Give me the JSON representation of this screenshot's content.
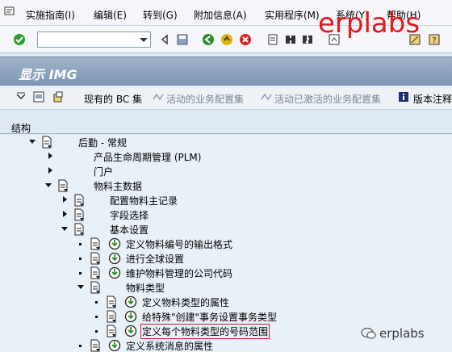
{
  "menubar": {
    "items": [
      "实施指南(I)",
      "编辑(E)",
      "转到(G)",
      "附加信息(A)",
      "实用程序(M)",
      "系统(Y)",
      "帮助(H)"
    ]
  },
  "watermark": {
    "logo": "erplabs",
    "bottom": "erplabs"
  },
  "toolbar": {
    "command_field": ""
  },
  "title": "显示 IMG",
  "app_toolbar": {
    "current_bc_set": "现有的 BC 集",
    "active_bc_set": "活动的业务配置集",
    "activated_bc_set": "活动已激活的业务配置集",
    "release_notes": "版本注释"
  },
  "tree": {
    "header": "结构",
    "nodes": [
      "后勤 - 常规",
      "产品生命周期管理 (PLM)",
      "门户",
      "物料主数据",
      "配置物料主记录",
      "字段选择",
      "基本设置",
      "定义物料编号的输出格式",
      "进行全球设置",
      "维护物料管理的公司代码",
      "物料类型",
      "定义物料类型的属性",
      "给特殊\"创建\"事务设置事务类型",
      "定义每个物料类型的号码范围",
      "定义系统消息的属性"
    ]
  },
  "colors": {
    "selection_border": "#d21f26",
    "title_bar": "#8aa1bb",
    "watermark": "#e8151b"
  }
}
